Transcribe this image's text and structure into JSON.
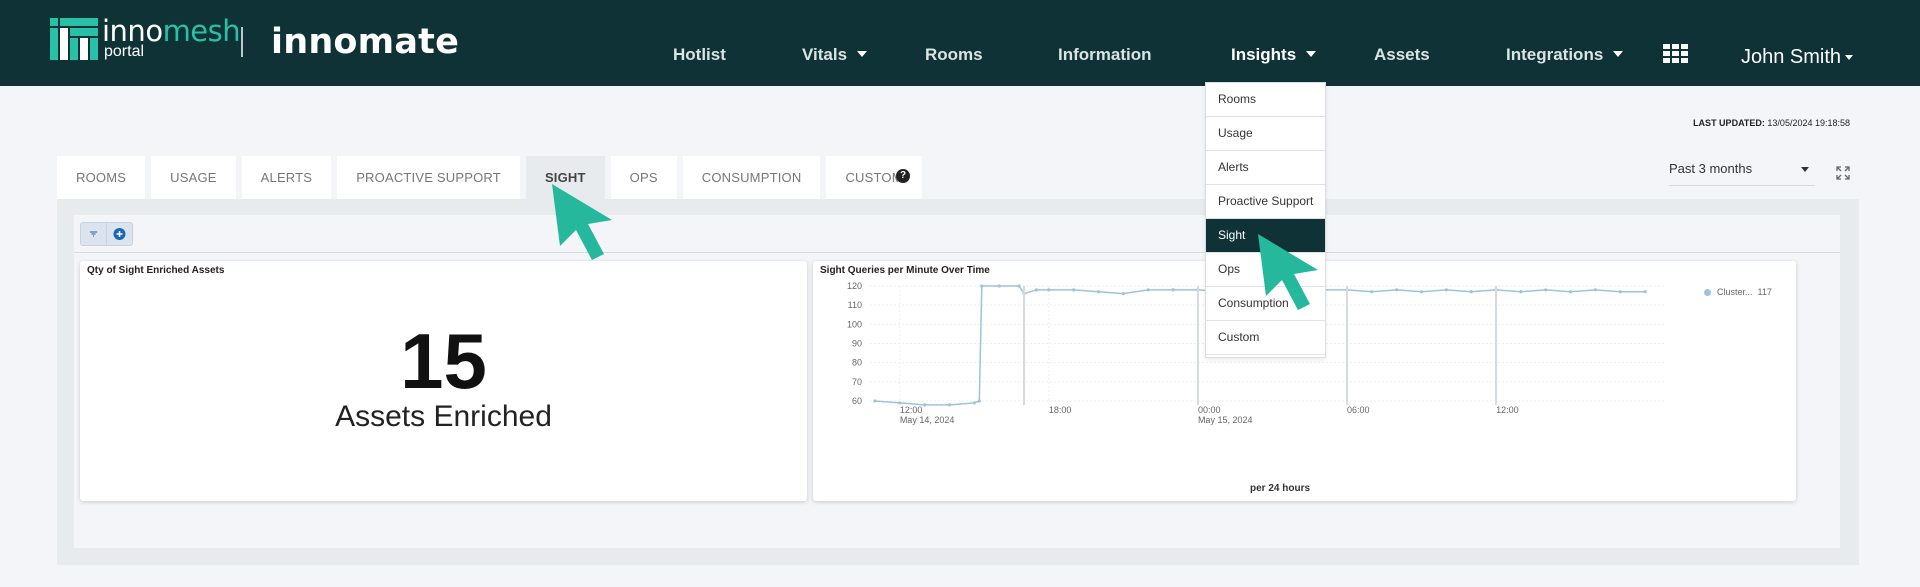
{
  "header": {
    "brand_main_pre": "inno",
    "brand_main_accent": "mesh",
    "brand_sub": "portal",
    "product": "innomate",
    "nav": [
      {
        "label": "Hotlist",
        "has_caret": false
      },
      {
        "label": "Vitals",
        "has_caret": true
      },
      {
        "label": "Rooms",
        "has_caret": false
      },
      {
        "label": "Information",
        "has_caret": false
      },
      {
        "label": "Insights",
        "has_caret": true,
        "active": true
      },
      {
        "label": "Assets",
        "has_caret": false
      },
      {
        "label": "Integrations",
        "has_caret": true
      }
    ],
    "user": "John Smith",
    "colors": {
      "bar": "#0e3236",
      "accent": "#29c0a8"
    }
  },
  "insights_menu": {
    "items": [
      "Rooms",
      "Usage",
      "Alerts",
      "Proactive Support",
      "Sight",
      "Ops",
      "Consumption",
      "Custom"
    ],
    "active": "Sight"
  },
  "last_updated": {
    "label": "LAST UPDATED:",
    "value": "13/05/2024 19:18:58"
  },
  "tabs": {
    "items": [
      "ROOMS",
      "USAGE",
      "ALERTS",
      "PROACTIVE SUPPORT",
      "SIGHT",
      "OPS",
      "CONSUMPTION",
      "CUSTOM"
    ],
    "active": "SIGHT"
  },
  "period": {
    "selected": "Past 3 months"
  },
  "cards": {
    "assets": {
      "title": "Qty of Sight Enriched Assets",
      "value": "15",
      "caption": "Assets Enriched"
    },
    "queries": {
      "title": "Sight Queries per Minute Over Time",
      "x_title": "per 24 hours",
      "legend_label": "Cluster...",
      "legend_value": "117"
    }
  },
  "chart_data": {
    "type": "line",
    "title": "Sight Queries per Minute Over Time",
    "xlabel": "per 24 hours",
    "ylabel": "",
    "ylim": [
      60,
      120
    ],
    "yticks": [
      120,
      110,
      100,
      90,
      80,
      70,
      60
    ],
    "xticks": [
      {
        "label": "12:00",
        "sublabel": "May 14, 2024",
        "hours": 0
      },
      {
        "label": "18:00",
        "sublabel": "",
        "hours": 6
      },
      {
        "label": "00:00",
        "sublabel": "May 15, 2024",
        "hours": 12
      },
      {
        "label": "06:00",
        "sublabel": "",
        "hours": 18
      },
      {
        "label": "12:00",
        "sublabel": "",
        "hours": 24
      }
    ],
    "xlim_hours": [
      -1.2,
      30.8
    ],
    "grid": true,
    "legend_placement": "top-right",
    "series": [
      {
        "name": "Cluster...",
        "last_value": 117,
        "color": "#9cc4dc",
        "points": [
          [
            -1.0,
            60
          ],
          [
            0.0,
            59
          ],
          [
            1.0,
            58
          ],
          [
            2.0,
            58
          ],
          [
            3.0,
            59
          ],
          [
            3.2,
            60
          ],
          [
            3.3,
            120
          ],
          [
            4.0,
            120
          ],
          [
            4.8,
            120
          ],
          [
            5.0,
            116
          ],
          [
            5.5,
            118
          ],
          [
            6.0,
            118
          ],
          [
            7.0,
            118
          ],
          [
            8.0,
            117
          ],
          [
            9.0,
            116
          ],
          [
            10.0,
            118
          ],
          [
            11.0,
            118
          ],
          [
            12.0,
            118
          ],
          [
            13.0,
            117
          ],
          [
            14.0,
            118
          ],
          [
            15.0,
            117
          ],
          [
            16.0,
            118
          ],
          [
            17.0,
            118
          ],
          [
            18.0,
            118
          ],
          [
            19.0,
            117
          ],
          [
            20.0,
            118
          ],
          [
            21.0,
            117
          ],
          [
            22.0,
            118
          ],
          [
            23.0,
            117
          ],
          [
            24.0,
            118
          ],
          [
            25.0,
            117
          ],
          [
            26.0,
            118
          ],
          [
            27.0,
            117
          ],
          [
            28.0,
            118
          ],
          [
            29.0,
            117
          ],
          [
            30.0,
            117
          ]
        ],
        "dips": [
          5.0,
          12.0,
          18.0,
          24.0
        ]
      }
    ]
  }
}
